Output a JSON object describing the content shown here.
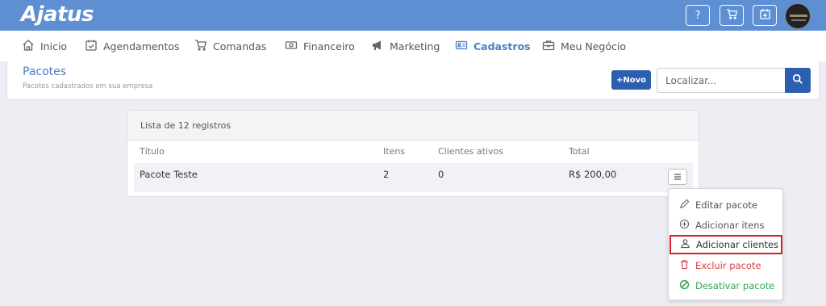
{
  "app": {
    "logo": "Ajatus"
  },
  "topbar": {
    "help_label": "?"
  },
  "nav": {
    "items": [
      {
        "label": "Inicio",
        "icon": "home-icon"
      },
      {
        "label": "Agendamentos",
        "icon": "calendar-check-icon"
      },
      {
        "label": "Comandas",
        "icon": "cart-icon"
      },
      {
        "label": "Financeiro",
        "icon": "money-icon"
      },
      {
        "label": "Marketing",
        "icon": "megaphone-icon"
      },
      {
        "label": "Cadastros",
        "icon": "id-card-icon",
        "active": true
      },
      {
        "label": "Meu Negócio",
        "icon": "briefcase-icon"
      }
    ]
  },
  "header": {
    "title": "Pacotes",
    "subtitle": "Pacotes cadastrados em sua empresa",
    "new_button": "+Novo",
    "search_placeholder": "Localizar..."
  },
  "list": {
    "count_label": "Lista de 12 registros",
    "columns": [
      "Título",
      "Itens",
      "Clientes ativos",
      "Total"
    ],
    "rows": [
      {
        "titulo": "Pacote Teste",
        "itens": "2",
        "clientes_ativos": "0",
        "total": "R$ 200,00"
      }
    ]
  },
  "menu": {
    "items": [
      {
        "label": "Editar pacote",
        "icon": "pencil-icon"
      },
      {
        "label": "Adicionar itens",
        "icon": "plus-circle-icon"
      },
      {
        "label": "Adicionar clientes",
        "icon": "user-icon",
        "highlighted": true
      },
      {
        "label": "Excluir pacote",
        "icon": "trash-icon",
        "color": "#e03c3c"
      },
      {
        "label": "Desativar pacote",
        "icon": "ban-icon",
        "color": "#2fa84f"
      }
    ]
  },
  "colors": {
    "topbar": "#5d8fd2",
    "accent": "#4a7fc9",
    "primary_button": "#2d5fb0",
    "highlight_border": "#d6202a"
  }
}
